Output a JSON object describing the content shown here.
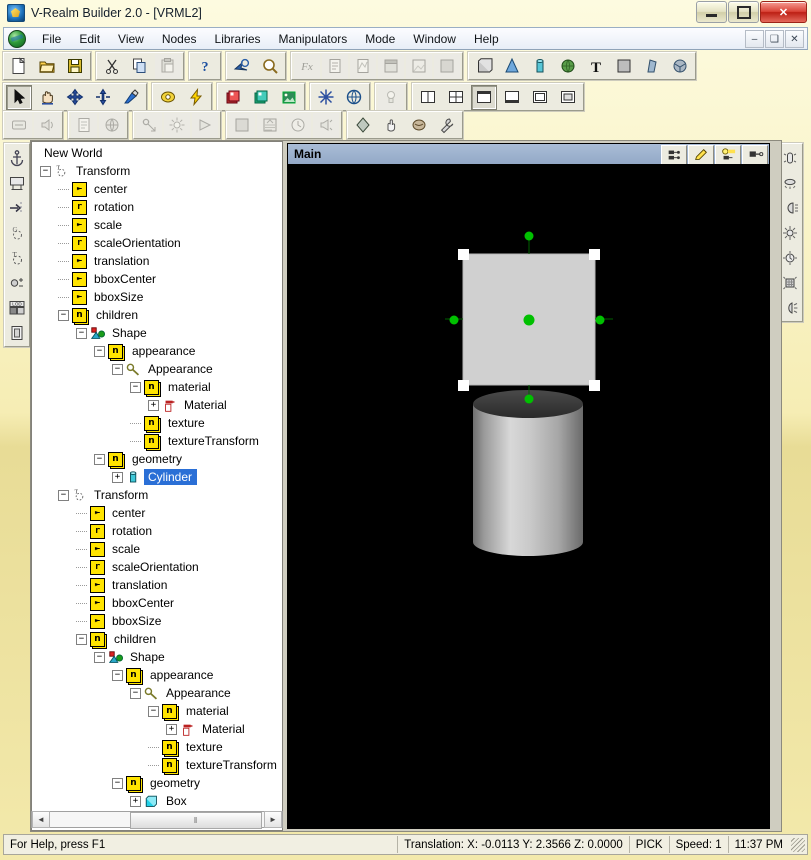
{
  "window": {
    "title": "V-Realm Builder 2.0 - [VRML2]",
    "app_icon": "vrealm-icon",
    "buttons": {
      "minimize": "minimize-button",
      "restore": "restore-button",
      "close": "close-button"
    }
  },
  "menubar": {
    "logo": "globe-icon",
    "items": [
      "File",
      "Edit",
      "View",
      "Nodes",
      "Libraries",
      "Manipulators",
      "Mode",
      "Window",
      "Help"
    ],
    "mdi_buttons": [
      "–",
      "❐",
      "×"
    ]
  },
  "toolbars": {
    "row1": [
      {
        "group": 1,
        "items": [
          {
            "name": "new-file-icon",
            "glyph": "page",
            "disabled": false
          },
          {
            "name": "open-file-icon",
            "glyph": "folder",
            "disabled": false
          },
          {
            "name": "save-file-icon",
            "glyph": "floppy",
            "disabled": false
          }
        ]
      },
      {
        "group": 2,
        "items": [
          {
            "name": "cut-icon",
            "glyph": "scissors",
            "disabled": false
          },
          {
            "name": "copy-icon",
            "glyph": "copy",
            "disabled": false
          },
          {
            "name": "paste-icon",
            "glyph": "paste",
            "disabled": true
          }
        ]
      },
      {
        "group": 3,
        "items": [
          {
            "name": "help-context-icon",
            "glyph": "question",
            "disabled": false
          }
        ]
      },
      {
        "group": 4,
        "items": [
          {
            "name": "select-node-icon",
            "glyph": "arrowmag",
            "disabled": false
          },
          {
            "name": "find-icon",
            "glyph": "magnifier",
            "disabled": false
          }
        ]
      },
      {
        "group": 5,
        "items": [
          {
            "name": "script-icon",
            "glyph": "fx",
            "disabled": true
          },
          {
            "name": "sensor-icon",
            "glyph": "sensor",
            "disabled": true
          },
          {
            "name": "interpolator-icon",
            "glyph": "interp",
            "disabled": true
          },
          {
            "name": "group-node-icon",
            "glyph": "grp1",
            "disabled": true
          },
          {
            "name": "texture-node-icon",
            "glyph": "grp2",
            "disabled": true
          },
          {
            "name": "background-node-icon",
            "glyph": "grp3",
            "disabled": true
          }
        ]
      },
      {
        "group": 6,
        "items": [
          {
            "name": "box-primitive-icon",
            "glyph": "boxp",
            "disabled": false
          },
          {
            "name": "cone-primitive-icon",
            "glyph": "cone",
            "disabled": false
          },
          {
            "name": "cylinder-primitive-icon",
            "glyph": "cyl",
            "disabled": false
          },
          {
            "name": "sphere-primitive-icon",
            "glyph": "sph",
            "disabled": false
          },
          {
            "name": "text-primitive-icon",
            "glyph": "textT",
            "disabled": false
          },
          {
            "name": "elevation-grid-icon",
            "glyph": "elev",
            "disabled": false
          },
          {
            "name": "extrusion-icon",
            "glyph": "extr",
            "disabled": false
          },
          {
            "name": "indexed-face-set-icon",
            "glyph": "ifs",
            "disabled": false
          }
        ]
      }
    ],
    "row2": [
      {
        "group": 1,
        "items": [
          {
            "name": "pointer-tool-icon",
            "glyph": "pointer",
            "disabled": false,
            "pressed": true
          },
          {
            "name": "pan-hand-tool-icon",
            "glyph": "hand",
            "disabled": false
          },
          {
            "name": "move-tool-icon",
            "glyph": "move4",
            "disabled": false
          },
          {
            "name": "scale-tool-icon",
            "glyph": "updown",
            "disabled": false
          },
          {
            "name": "rotate-tool-icon",
            "glyph": "rot",
            "disabled": false
          }
        ]
      },
      {
        "group": 2,
        "items": [
          {
            "name": "render-icon",
            "glyph": "render",
            "disabled": false
          },
          {
            "name": "fast-render-icon",
            "glyph": "bolt",
            "disabled": false
          }
        ]
      },
      {
        "group": 3,
        "items": [
          {
            "name": "layer-red-icon",
            "glyph": "lyr-r",
            "disabled": false
          },
          {
            "name": "layer-blue-icon",
            "glyph": "lyr-b",
            "disabled": false
          },
          {
            "name": "layer-image-icon",
            "glyph": "lyr-i",
            "disabled": false
          }
        ]
      },
      {
        "group": 4,
        "items": [
          {
            "name": "snap-icon",
            "glyph": "snap",
            "disabled": false
          },
          {
            "name": "world-globe-icon",
            "glyph": "globe",
            "disabled": false
          }
        ]
      },
      {
        "group": 5,
        "items": [
          {
            "name": "headlight-icon",
            "glyph": "headlight",
            "disabled": true
          }
        ]
      },
      {
        "group": 6,
        "items": [
          {
            "name": "split-vertical-icon",
            "glyph": "split-v",
            "disabled": false
          },
          {
            "name": "split-quad-icon",
            "glyph": "split-q",
            "disabled": false
          },
          {
            "name": "view-single-icon",
            "glyph": "view1",
            "disabled": false,
            "pressed": true
          },
          {
            "name": "view-bottom-icon",
            "glyph": "view2",
            "disabled": false
          },
          {
            "name": "view-top-icon",
            "glyph": "view3",
            "disabled": false
          },
          {
            "name": "view-full-icon",
            "glyph": "view4",
            "disabled": false
          }
        ]
      }
    ],
    "row3": [
      {
        "group": 1,
        "items": [
          {
            "name": "viewpoint-icon",
            "glyph": "vp",
            "disabled": true
          },
          {
            "name": "sound-icon",
            "glyph": "sound",
            "disabled": true
          }
        ]
      },
      {
        "group": 2,
        "items": [
          {
            "name": "inline-icon",
            "glyph": "inline",
            "disabled": true
          },
          {
            "name": "anchor-world-icon",
            "glyph": "anchorw",
            "disabled": true
          }
        ]
      },
      {
        "group": 3,
        "items": [
          {
            "name": "directional-light-icon",
            "glyph": "dirlight",
            "disabled": true
          },
          {
            "name": "point-light-icon",
            "glyph": "ptlight",
            "disabled": true
          },
          {
            "name": "spot-light-icon",
            "glyph": "spotlight",
            "disabled": true
          }
        ]
      },
      {
        "group": 4,
        "items": [
          {
            "name": "background-icon",
            "glyph": "bg",
            "disabled": true
          },
          {
            "name": "fog-icon",
            "glyph": "fog",
            "disabled": true
          },
          {
            "name": "time-sensor-icon",
            "glyph": "clock",
            "disabled": true
          },
          {
            "name": "audio-clip-icon",
            "glyph": "audio",
            "disabled": true
          }
        ]
      },
      {
        "group": 5,
        "items": [
          {
            "name": "shape-hint-icon",
            "glyph": "shape",
            "disabled": false
          },
          {
            "name": "touch-sensor-icon",
            "glyph": "touch",
            "disabled": false
          },
          {
            "name": "proximity-sensor-icon",
            "glyph": "prox",
            "disabled": false
          },
          {
            "name": "tools-options-icon",
            "glyph": "wrench",
            "disabled": false
          }
        ]
      }
    ],
    "left_vertical": [
      {
        "name": "anchor-icon",
        "glyph": "anchor"
      },
      {
        "name": "billboard-icon",
        "glyph": "billboard"
      },
      {
        "name": "collision-icon",
        "glyph": "collision"
      },
      {
        "name": "group-icon",
        "glyph": "groupG"
      },
      {
        "name": "transform-icon",
        "glyph": "transformT"
      },
      {
        "name": "switch-icon",
        "glyph": "switch"
      },
      {
        "name": "lod-icon",
        "glyph": "LOD"
      },
      {
        "name": "proto-icon",
        "glyph": "proto"
      }
    ],
    "right_vertical": [
      {
        "name": "light-tube-icon",
        "glyph": "rl1"
      },
      {
        "name": "light-disc-icon",
        "glyph": "rl2"
      },
      {
        "name": "light-cone-icon",
        "glyph": "rl3"
      },
      {
        "name": "light-point-icon",
        "glyph": "rl4"
      },
      {
        "name": "light-clock-icon",
        "glyph": "rl5"
      },
      {
        "name": "light-grid-icon",
        "glyph": "rl6"
      },
      {
        "name": "light-spot-icon",
        "glyph": "rl7"
      }
    ]
  },
  "tree": {
    "root_label": "New World",
    "nodes": [
      {
        "label": "New World",
        "depth": 0,
        "icon": "none",
        "expander": "none",
        "selected": false
      },
      {
        "label": "Transform",
        "depth": 0,
        "icon": "transform",
        "expander": "minus",
        "selected": false
      },
      {
        "label": "center",
        "depth": 1,
        "icon": "field-mf",
        "expander": "none",
        "selected": false
      },
      {
        "label": "rotation",
        "depth": 1,
        "icon": "field-r",
        "expander": "none",
        "selected": false
      },
      {
        "label": "scale",
        "depth": 1,
        "icon": "field-mf",
        "expander": "none",
        "selected": false
      },
      {
        "label": "scaleOrientation",
        "depth": 1,
        "icon": "field-r",
        "expander": "none",
        "selected": false
      },
      {
        "label": "translation",
        "depth": 1,
        "icon": "field-mf",
        "expander": "none",
        "selected": false
      },
      {
        "label": "bboxCenter",
        "depth": 1,
        "icon": "field-mf",
        "expander": "none",
        "selected": false
      },
      {
        "label": "bboxSize",
        "depth": 1,
        "icon": "field-mf",
        "expander": "none",
        "selected": false
      },
      {
        "label": "children",
        "depth": 1,
        "icon": "node-n",
        "expander": "minus",
        "selected": false
      },
      {
        "label": "Shape",
        "depth": 2,
        "icon": "shape",
        "expander": "minus",
        "selected": false
      },
      {
        "label": "appearance",
        "depth": 3,
        "icon": "node-n",
        "expander": "minus",
        "selected": false
      },
      {
        "label": "Appearance",
        "depth": 4,
        "icon": "appearance",
        "expander": "minus",
        "selected": false
      },
      {
        "label": "material",
        "depth": 5,
        "icon": "node-n",
        "expander": "minus",
        "selected": false
      },
      {
        "label": "Material",
        "depth": 6,
        "icon": "material",
        "expander": "plus",
        "selected": false
      },
      {
        "label": "texture",
        "depth": 5,
        "icon": "node-n",
        "expander": "none",
        "selected": false
      },
      {
        "label": "textureTransform",
        "depth": 5,
        "icon": "node-n",
        "expander": "none",
        "selected": false
      },
      {
        "label": "geometry",
        "depth": 3,
        "icon": "node-n",
        "expander": "minus",
        "selected": false
      },
      {
        "label": "Cylinder",
        "depth": 4,
        "icon": "cylinder",
        "expander": "plus",
        "selected": true
      },
      {
        "label": "Transform",
        "depth": 1,
        "icon": "transform",
        "expander": "minus",
        "selected": false
      },
      {
        "label": "center",
        "depth": 2,
        "icon": "field-mf",
        "expander": "none",
        "selected": false
      },
      {
        "label": "rotation",
        "depth": 2,
        "icon": "field-r",
        "expander": "none",
        "selected": false
      },
      {
        "label": "scale",
        "depth": 2,
        "icon": "field-mf",
        "expander": "none",
        "selected": false
      },
      {
        "label": "scaleOrientation",
        "depth": 2,
        "icon": "field-r",
        "expander": "none",
        "selected": false
      },
      {
        "label": "translation",
        "depth": 2,
        "icon": "field-mf",
        "expander": "none",
        "selected": false
      },
      {
        "label": "bboxCenter",
        "depth": 2,
        "icon": "field-mf",
        "expander": "none",
        "selected": false
      },
      {
        "label": "bboxSize",
        "depth": 2,
        "icon": "field-mf",
        "expander": "none",
        "selected": false
      },
      {
        "label": "children",
        "depth": 2,
        "icon": "node-n",
        "expander": "minus",
        "selected": false
      },
      {
        "label": "Shape",
        "depth": 3,
        "icon": "shape",
        "expander": "minus",
        "selected": false
      },
      {
        "label": "appearance",
        "depth": 4,
        "icon": "node-n",
        "expander": "minus",
        "selected": false
      },
      {
        "label": "Appearance",
        "depth": 5,
        "icon": "appearance",
        "expander": "minus",
        "selected": false
      },
      {
        "label": "material",
        "depth": 6,
        "icon": "node-n",
        "expander": "minus",
        "selected": false
      },
      {
        "label": "Material",
        "depth": 7,
        "icon": "material",
        "expander": "plus",
        "selected": false
      },
      {
        "label": "texture",
        "depth": 6,
        "icon": "node-n",
        "expander": "none",
        "selected": false
      },
      {
        "label": "textureTransform",
        "depth": 6,
        "icon": "node-n",
        "expander": "none",
        "selected": false
      },
      {
        "label": "geometry",
        "depth": 4,
        "icon": "node-n",
        "expander": "minus",
        "selected": false
      },
      {
        "label": "Box",
        "depth": 5,
        "icon": "box",
        "expander": "plus",
        "selected": false
      }
    ],
    "scrollbar": {
      "left_arrow": "◄",
      "right_arrow": "►",
      "thumb_grip": "‖"
    }
  },
  "viewport": {
    "title": "Main",
    "buttons": [
      {
        "name": "viewport-render-button",
        "glyph": "vb1"
      },
      {
        "name": "viewport-edit-button",
        "glyph": "vb2"
      },
      {
        "name": "viewport-light-button",
        "glyph": "vb3"
      },
      {
        "name": "viewport-camera-button",
        "glyph": "vb4"
      }
    ],
    "scene": {
      "background_color": "#000000",
      "objects": [
        {
          "name": "box-object",
          "type": "box",
          "selected": true,
          "fill": "#d0d0d0"
        },
        {
          "name": "cylinder-object",
          "type": "cylinder",
          "selected": false,
          "fill": "#c8c8c8"
        }
      ],
      "handle_color": "#00c000",
      "corner_handle_color": "#ffffff"
    }
  },
  "statusbar": {
    "hint": "For Help, press F1",
    "translation": "Translation: X: -0.0113  Y: 2.3566  Z: 0.0000",
    "mode": "PICK",
    "speed": "Speed: 1",
    "time": "11:37 PM"
  }
}
